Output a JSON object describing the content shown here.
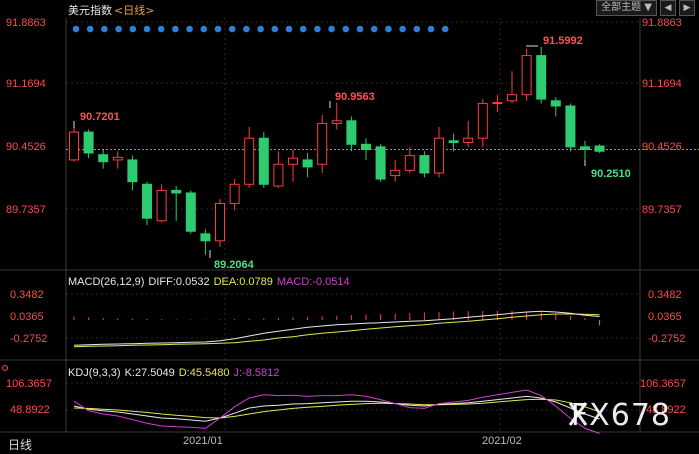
{
  "header": {
    "title": "美元指数",
    "period_tag": "<日线>"
  },
  "toolbar": {
    "theme_label": "全部主题",
    "theme_arrow": "▼",
    "prev_icon": "chevron-left-icon",
    "next_icon": "chevron-right-icon"
  },
  "price_axis": {
    "labels": [
      "91.8863",
      "91.1694",
      "90.4526",
      "89.7357"
    ],
    "reference_line": 90.42
  },
  "markers": {
    "high_left": "90.7201",
    "mid_high": "90.9563",
    "low": "89.2064",
    "top": "91.5992",
    "last": "90.2510"
  },
  "macd": {
    "legend": "MACD(26,12,9)",
    "diff": "DIFF:0.0532",
    "dea": "DEA:0.0789",
    "macd": "MACD:-0.0514",
    "axis_labels": [
      "0.3482",
      "0.0365",
      "-0.2752"
    ]
  },
  "kdj": {
    "legend": "KDJ(9,3,3)",
    "k": "K:27.5049",
    "d": "D:45.5480",
    "j": "J:-8.5812",
    "axis_labels": [
      "106.3657",
      "48.8922"
    ]
  },
  "time_axis": {
    "labels": [
      "2021/01",
      "2021/02"
    ]
  },
  "bottom": {
    "period_label": "日线"
  },
  "watermark": "FX678",
  "colors": {
    "up": "#ff3d3d",
    "down": "#2ecc71",
    "dots": "#2f7fd6",
    "diff": "#e8e8e8",
    "dea": "#e6e64d",
    "j": "#d040d0",
    "marker_red": "#ff5050",
    "marker_green": "#4ce08a",
    "axis_red": "#ff4a4a"
  },
  "chart_data": {
    "type": "candlestick",
    "candles": [
      {
        "o": 90.3,
        "c": 90.62,
        "h": 90.72,
        "l": 90.28
      },
      {
        "o": 90.62,
        "c": 90.38,
        "h": 90.65,
        "l": 90.32
      },
      {
        "o": 90.36,
        "c": 90.28,
        "h": 90.42,
        "l": 90.2
      },
      {
        "o": 90.3,
        "c": 90.33,
        "h": 90.4,
        "l": 90.2
      },
      {
        "o": 90.3,
        "c": 90.05,
        "h": 90.35,
        "l": 89.95
      },
      {
        "o": 90.02,
        "c": 89.63,
        "h": 90.05,
        "l": 89.55
      },
      {
        "o": 89.6,
        "c": 89.95,
        "h": 90.02,
        "l": 89.58
      },
      {
        "o": 89.95,
        "c": 89.92,
        "h": 90.0,
        "l": 89.6
      },
      {
        "o": 89.92,
        "c": 89.48,
        "h": 89.95,
        "l": 89.45
      },
      {
        "o": 89.45,
        "c": 89.37,
        "h": 89.5,
        "l": 89.21
      },
      {
        "o": 89.37,
        "c": 89.8,
        "h": 89.85,
        "l": 89.3
      },
      {
        "o": 89.8,
        "c": 90.02,
        "h": 90.08,
        "l": 89.72
      },
      {
        "o": 90.02,
        "c": 90.55,
        "h": 90.68,
        "l": 89.98
      },
      {
        "o": 90.55,
        "c": 90.02,
        "h": 90.62,
        "l": 89.98
      },
      {
        "o": 90.0,
        "c": 90.25,
        "h": 90.4,
        "l": 89.98
      },
      {
        "o": 90.25,
        "c": 90.32,
        "h": 90.42,
        "l": 90.05
      },
      {
        "o": 90.3,
        "c": 90.22,
        "h": 90.38,
        "l": 90.1
      },
      {
        "o": 90.25,
        "c": 90.72,
        "h": 90.82,
        "l": 90.15
      },
      {
        "o": 90.72,
        "c": 90.75,
        "h": 90.96,
        "l": 90.65
      },
      {
        "o": 90.75,
        "c": 90.48,
        "h": 90.8,
        "l": 90.4
      },
      {
        "o": 90.48,
        "c": 90.42,
        "h": 90.55,
        "l": 90.3
      },
      {
        "o": 90.45,
        "c": 90.08,
        "h": 90.48,
        "l": 90.05
      },
      {
        "o": 90.12,
        "c": 90.18,
        "h": 90.3,
        "l": 90.05
      },
      {
        "o": 90.18,
        "c": 90.35,
        "h": 90.45,
        "l": 90.15
      },
      {
        "o": 90.35,
        "c": 90.15,
        "h": 90.4,
        "l": 90.1
      },
      {
        "o": 90.15,
        "c": 90.55,
        "h": 90.68,
        "l": 90.1
      },
      {
        "o": 90.52,
        "c": 90.5,
        "h": 90.6,
        "l": 90.4
      },
      {
        "o": 90.5,
        "c": 90.55,
        "h": 90.75,
        "l": 90.45
      },
      {
        "o": 90.55,
        "c": 90.95,
        "h": 91.0,
        "l": 90.45
      },
      {
        "o": 90.95,
        "c": 90.96,
        "h": 91.05,
        "l": 90.85
      },
      {
        "o": 90.98,
        "c": 91.05,
        "h": 91.32,
        "l": 90.95
      },
      {
        "o": 91.05,
        "c": 91.5,
        "h": 91.58,
        "l": 90.98
      },
      {
        "o": 91.5,
        "c": 91.0,
        "h": 91.6,
        "l": 90.95
      },
      {
        "o": 90.98,
        "c": 90.92,
        "h": 91.02,
        "l": 90.8
      },
      {
        "o": 90.92,
        "c": 90.45,
        "h": 90.95,
        "l": 90.4
      },
      {
        "o": 90.45,
        "c": 90.42,
        "h": 90.52,
        "l": 90.25
      },
      {
        "o": 90.46,
        "c": 90.4,
        "h": 90.48,
        "l": 90.38
      }
    ],
    "macd_hist": [
      0.03,
      0.025,
      0.02,
      0.015,
      0.012,
      0.01,
      0.008,
      0.006,
      0.005,
      0.004,
      0.006,
      0.008,
      0.012,
      0.016,
      0.02,
      0.025,
      0.03,
      0.035,
      0.04,
      0.045,
      0.05,
      0.055,
      0.06,
      0.065,
      0.07,
      0.075,
      0.08,
      0.082,
      0.085,
      0.086,
      0.085,
      0.08,
      0.07,
      0.055,
      0.04,
      0.02,
      -0.0514
    ],
    "macd_diff": [
      -0.38,
      -0.37,
      -0.365,
      -0.36,
      -0.355,
      -0.35,
      -0.345,
      -0.34,
      -0.335,
      -0.33,
      -0.31,
      -0.28,
      -0.24,
      -0.2,
      -0.17,
      -0.14,
      -0.11,
      -0.09,
      -0.07,
      -0.06,
      -0.05,
      -0.04,
      -0.03,
      -0.02,
      -0.01,
      0.005,
      0.02,
      0.04,
      0.06,
      0.08,
      0.1,
      0.12,
      0.13,
      0.12,
      0.1,
      0.07,
      0.0532
    ],
    "macd_dea": [
      -0.4,
      -0.395,
      -0.39,
      -0.385,
      -0.38,
      -0.375,
      -0.37,
      -0.365,
      -0.36,
      -0.355,
      -0.35,
      -0.34,
      -0.32,
      -0.3,
      -0.27,
      -0.25,
      -0.22,
      -0.2,
      -0.18,
      -0.16,
      -0.14,
      -0.12,
      -0.1,
      -0.085,
      -0.07,
      -0.05,
      -0.035,
      -0.02,
      0.0,
      0.02,
      0.04,
      0.06,
      0.08,
      0.09,
      0.09,
      0.085,
      0.0789
    ],
    "macd_range": [
      -0.45,
      0.45
    ],
    "kdj_k": [
      60,
      52,
      48,
      45,
      40,
      35,
      30,
      28,
      25,
      22,
      30,
      42,
      55,
      60,
      62,
      65,
      66,
      68,
      70,
      72,
      72,
      70,
      66,
      62,
      60,
      64,
      66,
      68,
      72,
      76,
      80,
      84,
      80,
      70,
      55,
      40,
      27.5
    ],
    "kdj_d": [
      55,
      54,
      52,
      50,
      47,
      44,
      40,
      37,
      34,
      31,
      30,
      34,
      40,
      46,
      50,
      54,
      57,
      59,
      62,
      64,
      66,
      67,
      66,
      65,
      63,
      63,
      64,
      65,
      67,
      70,
      73,
      76,
      77,
      75,
      68,
      58,
      45.5
    ],
    "kdj_j": [
      72,
      48,
      40,
      35,
      26,
      17,
      10,
      8,
      7,
      4,
      30,
      58,
      80,
      88,
      86,
      87,
      84,
      86,
      86,
      88,
      84,
      76,
      66,
      56,
      54,
      66,
      70,
      74,
      82,
      88,
      94,
      100,
      86,
      60,
      29,
      4,
      -8.6
    ],
    "kdj_range": [
      -10,
      130
    ],
    "dots_count": 27
  }
}
